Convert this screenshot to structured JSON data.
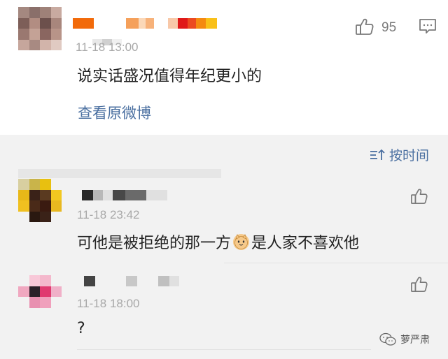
{
  "main_comment": {
    "time": "11-18 13:00",
    "text": "说实话盛况值得年纪更小的",
    "view_original": "查看原微博",
    "like_count": "95"
  },
  "sort": {
    "label": "按时间"
  },
  "replies": [
    {
      "time": "11-18 23:42",
      "text_before": "可他是被拒绝的那一方",
      "text_after": "是人家不喜欢他"
    },
    {
      "time": "11-18 18:00",
      "text": "?"
    }
  ],
  "watermark": {
    "label": "萝严肃"
  },
  "icons": {
    "like": "thumbs-up-icon",
    "comment": "comment-icon",
    "sort": "sort-icon",
    "emoji": "cat-emoji-icon",
    "wechat": "wechat-icon"
  },
  "colors": {
    "link": "#4a6fa0",
    "time": "#a8a8a8",
    "text": "#222222"
  }
}
